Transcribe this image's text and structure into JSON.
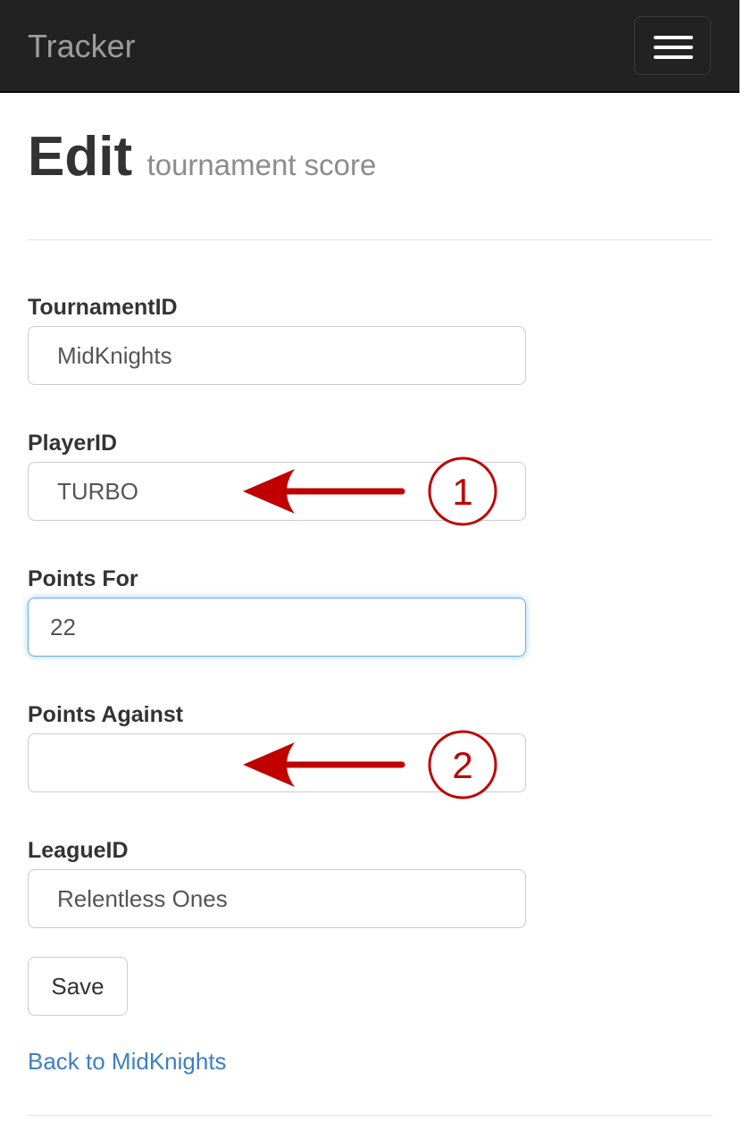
{
  "navbar": {
    "brand": "Tracker",
    "toggle_icon": "hamburger-icon"
  },
  "header": {
    "title": "Edit",
    "subtitle": "tournament score"
  },
  "form": {
    "tournament_id": {
      "label": "TournamentID",
      "value": "MidKnights"
    },
    "player_id": {
      "label": "PlayerID",
      "value": "TURBO"
    },
    "points_for": {
      "label": "Points For",
      "value": "22"
    },
    "points_against": {
      "label": "Points Against",
      "value": ""
    },
    "league_id": {
      "label": "LeagueID",
      "value": "Relentless Ones"
    },
    "save_label": "Save"
  },
  "back_link": "Back to MidKnights",
  "annotations": [
    {
      "number": "1",
      "color": "#c00000"
    },
    {
      "number": "2",
      "color": "#c00000"
    }
  ]
}
